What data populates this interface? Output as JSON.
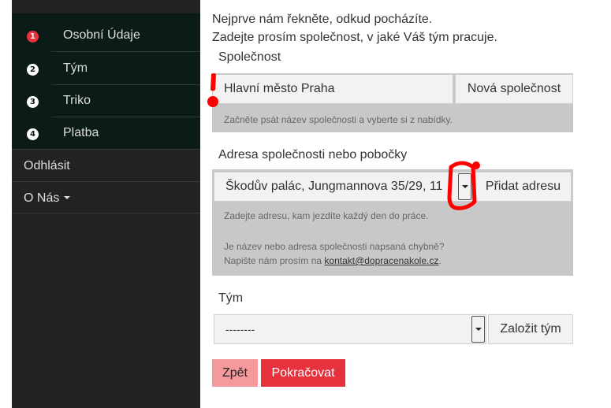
{
  "sidebar": {
    "steps": [
      {
        "num": "1",
        "label": "Osobní Údaje"
      },
      {
        "num": "2",
        "label": "Tým"
      },
      {
        "num": "3",
        "label": "Triko"
      },
      {
        "num": "4",
        "label": "Platba"
      }
    ],
    "logout": "Odhlásit",
    "about": "O Nás"
  },
  "main": {
    "intro_line1": "Nejprve nám řekněte, odkud pocházíte.",
    "intro_line2": "Zadejte prosím společnost, v jaké Váš tým pracuje.",
    "company": {
      "label": "Společnost",
      "value": "Hlavní město Praha",
      "new_button": "Nová společnost",
      "help": "Začněte psát název společnosti a vyberte si z nabídky."
    },
    "address": {
      "label": "Adresa společnosti nebo pobočky",
      "value": "Škodův palác, Jungmannova 35/29, 11",
      "add_button": "Přidat adresu",
      "help": "Zadejte adresu, kam jezdíte každý den do práce.",
      "error_line1": "Je název nebo adresa společnosti napsaná chybně?",
      "error_line2_prefix": "Napište nám prosím na ",
      "email": "kontakt@dopracenakole.cz",
      "error_line2_suffix": "."
    },
    "team": {
      "label": "Tým",
      "value": "--------",
      "create_button": "Založit tým"
    },
    "back_button": "Zpět",
    "next_button": "Pokračovat"
  },
  "colors": {
    "accent": "#e7323e",
    "back_button": "#f49a9d",
    "sidebar": "#222222",
    "sidebar_steps": "#0b1c18",
    "well": "#c8c8c8"
  }
}
